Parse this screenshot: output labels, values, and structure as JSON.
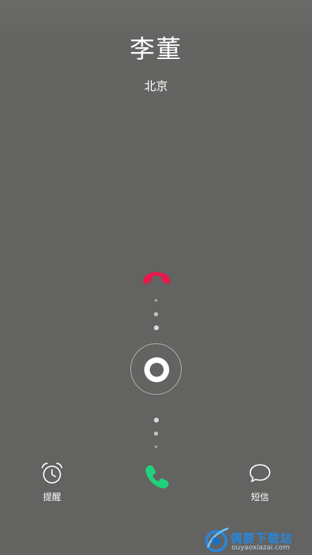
{
  "caller": {
    "name": "李董",
    "location": "北京"
  },
  "actions": {
    "remind_label": "提醒",
    "sms_label": "短信"
  },
  "icons": {
    "decline": "phone-hangup-icon",
    "answer": "phone-answer-icon",
    "remind": "alarm-clock-icon",
    "sms": "chat-bubble-icon"
  },
  "colors": {
    "background": "#636361",
    "decline": "#e8194a",
    "answer": "#1fd17a",
    "text": "#ffffff"
  },
  "watermark": {
    "title": "偶要下载站",
    "url": "ouyaoxiazai.com"
  }
}
